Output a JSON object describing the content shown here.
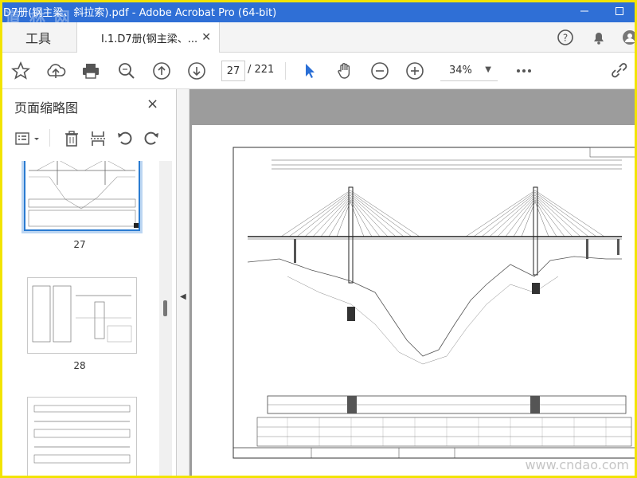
{
  "window": {
    "title": "D7册(钢主梁、斜拉索).pdf - Adobe Acrobat Pro (64-bit)",
    "minimize_icon": "minimize-icon",
    "maximize_icon": "maximize-icon"
  },
  "watermark_text": "道 林 网",
  "tabs": {
    "tools_label": "工具",
    "doc_label": "I.1.D7册(钢主梁、...",
    "help_icon": "help-icon",
    "bell_icon": "bell-icon",
    "account_icon": "account-icon"
  },
  "toolbar": {
    "bookmark_icon": "star-icon",
    "upload_icon": "cloud-upload-icon",
    "print_icon": "printer-icon",
    "search_icon": "search-icon",
    "prev_page_icon": "arrow-up-circle-icon",
    "next_page_icon": "arrow-down-circle-icon",
    "current_page": "27",
    "total_pages": "/ 221",
    "select_icon": "cursor-icon",
    "hand_icon": "hand-icon",
    "zoom_out_icon": "zoom-out-icon",
    "zoom_in_icon": "zoom-in-icon",
    "zoom_level": "34%",
    "more_icon": "more-icon",
    "link_icon": "link-icon"
  },
  "sidebar": {
    "title": "页面缩略图",
    "close": "×",
    "tools": [
      "options-icon",
      "trash-icon",
      "crop-icon",
      "undo-icon",
      "redo-icon"
    ],
    "thumbnails": [
      {
        "label": "27",
        "selected": true
      },
      {
        "label": "28",
        "selected": false
      },
      {
        "label": "",
        "selected": false
      }
    ]
  },
  "footer_watermark": "www.cndao.com"
}
